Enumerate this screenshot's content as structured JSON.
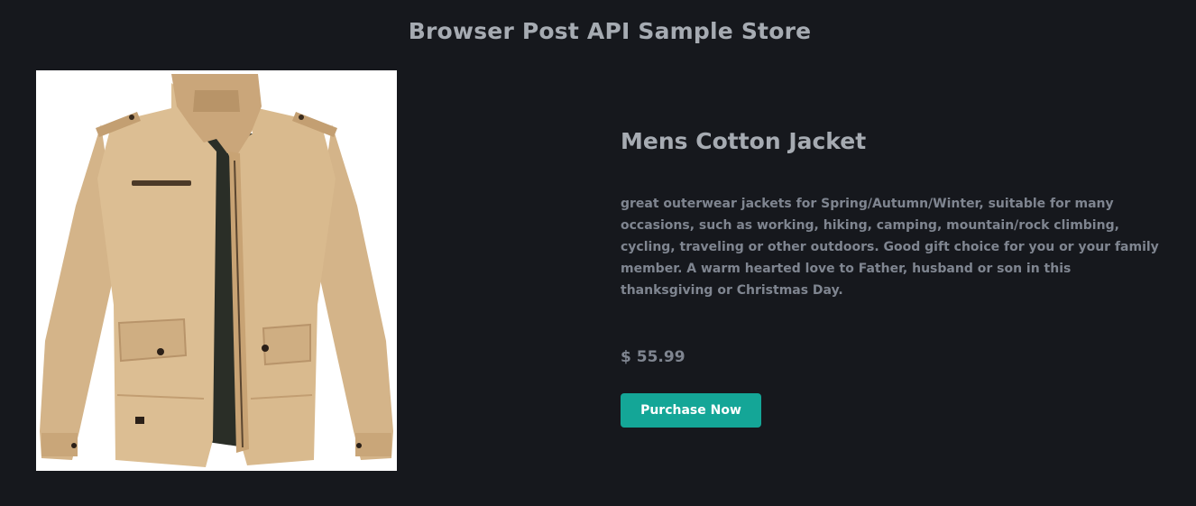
{
  "header": {
    "title": "Browser Post API Sample Store"
  },
  "product": {
    "image_icon": "jacket-image",
    "name": "Mens Cotton Jacket",
    "description": "great outerwear jackets for Spring/Autumn/Winter, suitable for many occasions, such as working, hiking, camping, mountain/rock climbing, cycling, traveling or other outdoors. Good gift choice for you or your family member. A warm hearted love to Father, husband or son in this thanksgiving or Christmas Day.",
    "price": "$ 55.99",
    "purchase_label": "Purchase Now"
  },
  "colors": {
    "background": "#16181d",
    "heading_text": "#a6abb2",
    "body_text": "#7f8590",
    "button_bg": "#14a697",
    "button_text": "#ffffff",
    "jacket_khaki": "#d7b98e",
    "jacket_lining": "#2a2e27"
  }
}
